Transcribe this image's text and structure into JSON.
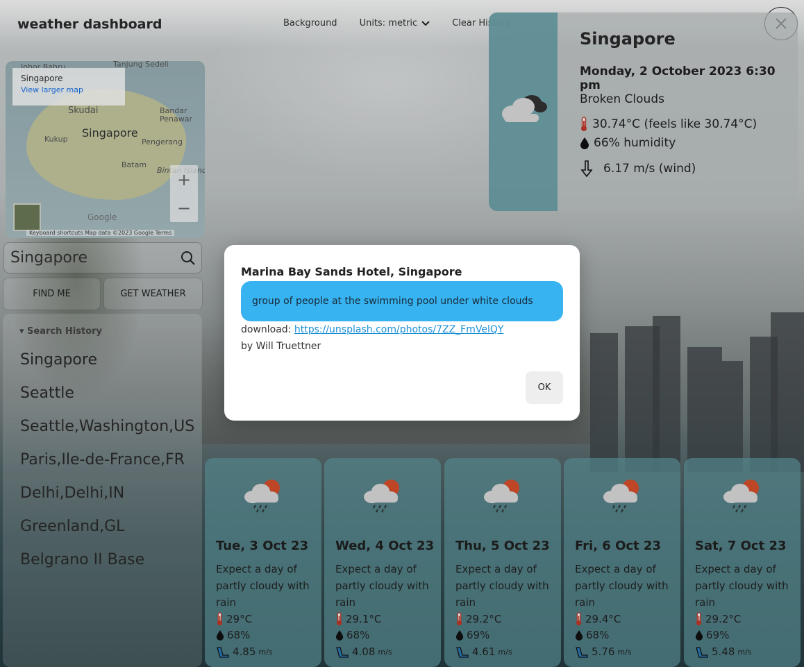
{
  "header": {
    "brand": "weather dashboard",
    "nav": {
      "background": "Background",
      "units": "Units: metric",
      "clear_history": "Clear History"
    }
  },
  "map": {
    "infobox_title": "Singapore",
    "infobox_link": "View larger map",
    "labels": {
      "johor": "Johor Bahru",
      "tanjung": "Tanjung Sedeli",
      "skudai": "Skudai",
      "bandar": "Bandar Penawar",
      "kukup": "Kukup",
      "singapore": "Singapore",
      "pengerang": "Pengerang",
      "batam": "Batam",
      "bintan": "Bintan Island"
    },
    "footer": "Keyboard shortcuts   Map data ©2023 Google   Terms",
    "google": "Google"
  },
  "search": {
    "value": "Singapore",
    "find_me": "FIND ME",
    "get_weather": "GET WEATHER"
  },
  "history": {
    "header": "▾ Search History",
    "items": [
      "Singapore",
      "Seattle",
      "Seattle,Washington,US",
      "Paris,Ile-de-France,FR",
      "Delhi,Delhi,IN",
      "Greenland,GL",
      "Belgrano II Base"
    ]
  },
  "current": {
    "city": "Singapore",
    "datetime": "Monday, 2 October 2023 6:30 pm",
    "description": "Broken Clouds",
    "temperature": "30.74°C (feels like 30.74°C)",
    "humidity": "66% humidity",
    "wind": "6.17 m/s (wind)"
  },
  "forecast": [
    {
      "day": "Tue, 3 Oct 23",
      "text": "Expect a day of partly cloudy with rain",
      "temp": "29°C",
      "humidity": "68%",
      "wind": "4.85",
      "unit": "m/s"
    },
    {
      "day": "Wed, 4 Oct 23",
      "text": "Expect a day of partly cloudy with rain",
      "temp": "29.1°C",
      "humidity": "68%",
      "wind": "4.08",
      "unit": "m/s"
    },
    {
      "day": "Thu, 5 Oct 23",
      "text": "Expect a day of partly cloudy with rain",
      "temp": "29.2°C",
      "humidity": "69%",
      "wind": "4.61",
      "unit": "m/s"
    },
    {
      "day": "Fri, 6 Oct 23",
      "text": "Expect a day of partly cloudy with rain",
      "temp": "29.4°C",
      "humidity": "68%",
      "wind": "5.76",
      "unit": "m/s"
    },
    {
      "day": "Sat, 7 Oct 23",
      "text": "Expect a day of partly cloudy with rain",
      "temp": "29.2°C",
      "humidity": "69%",
      "wind": "5.48",
      "unit": "m/s"
    }
  ],
  "modal": {
    "title": "Marina Bay Sands Hotel, Singapore",
    "caption": "group of people at the swimming pool under white clouds",
    "download_label": "download: ",
    "download_link": "https://unsplash.com/photos/7ZZ_FmVelQY",
    "by": "by Will Truettner",
    "ok": "OK"
  },
  "icons": {
    "close": "close-icon",
    "search": "search-icon",
    "chevron": "chevron-down-icon",
    "cloud": "broken-clouds-icon",
    "rain": "partly-cloudy-rain-icon",
    "thermometer": "thermometer-icon",
    "drop": "humidity-drop-icon",
    "wind": "wind-icon"
  },
  "colors": {
    "accent": "#36b3f0",
    "card_strip": "#629ea6",
    "sun": "#d9502c"
  }
}
